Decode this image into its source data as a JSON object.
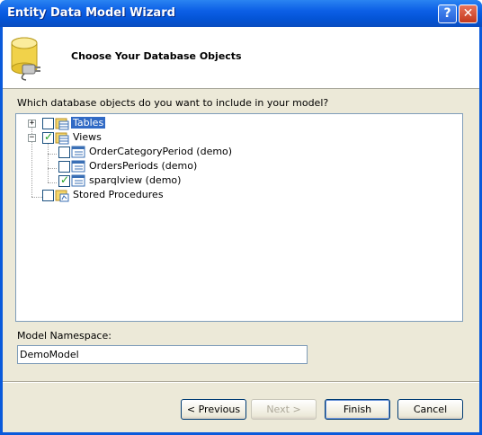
{
  "window": {
    "title": "Entity Data Model Wizard",
    "help_glyph": "?",
    "close_glyph": "✕"
  },
  "header": {
    "title": "Choose Your Database Objects"
  },
  "prompt": "Which database objects do you want to include in your model?",
  "tree": {
    "tables": {
      "label": "Tables",
      "expanded": false,
      "checked": false,
      "selected": true
    },
    "views": {
      "label": "Views",
      "expanded": true,
      "checked": true,
      "children": [
        {
          "label": "OrderCategoryPeriod (demo)",
          "checked": false
        },
        {
          "label": "OrdersPeriods (demo)",
          "checked": false
        },
        {
          "label": "sparqlview (demo)",
          "checked": true
        }
      ]
    },
    "procedures": {
      "label": "Stored Procedures",
      "checked": false
    }
  },
  "namespace": {
    "label": "Model Namespace:",
    "value": "DemoModel"
  },
  "buttons": {
    "previous": "< Previous",
    "next": "Next >",
    "finish": "Finish",
    "cancel": "Cancel"
  }
}
